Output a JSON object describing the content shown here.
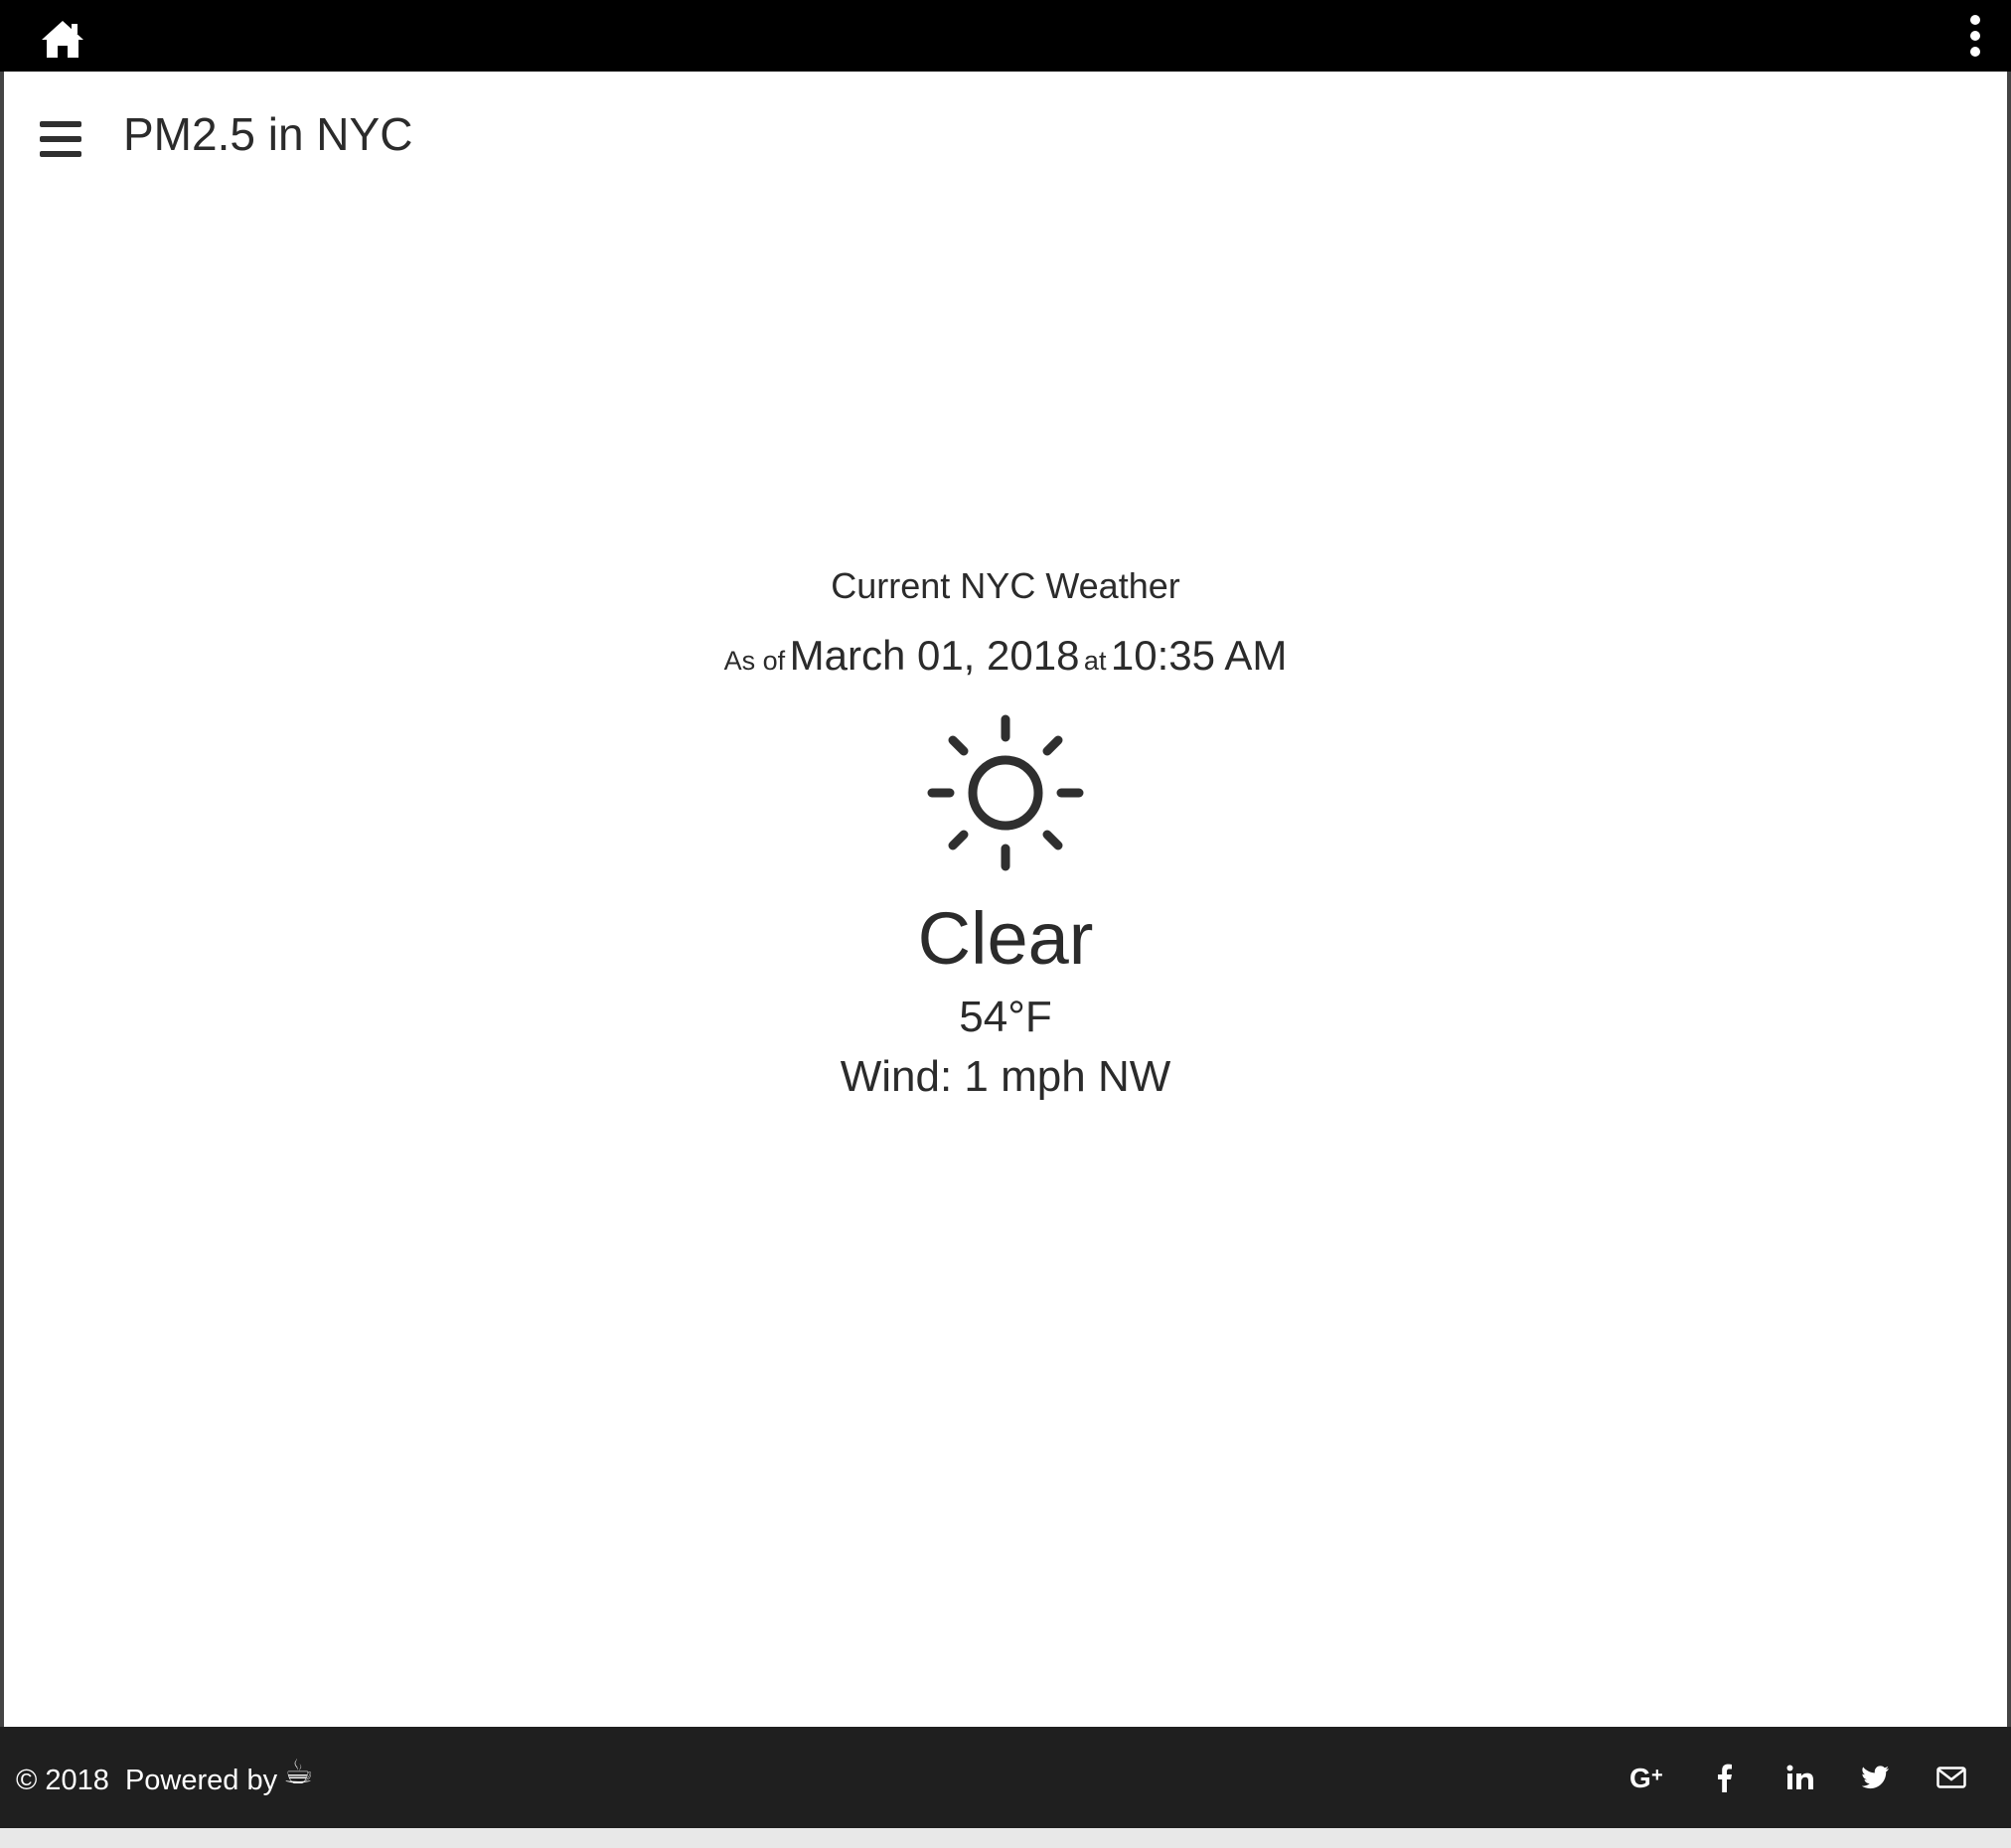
{
  "app": {
    "title": "PM2.5 in NYC"
  },
  "weather": {
    "heading": "Current NYC Weather",
    "as_of_prefix": "As of",
    "date": "March 01, 2018",
    "at_word": "at",
    "time": "10:35 AM",
    "icon": "sun-icon",
    "condition": "Clear",
    "temperature": "54°F",
    "wind": "Wind: 1 mph NW"
  },
  "footer": {
    "copyright": "© 2018",
    "powered_by": "Powered by",
    "powered_icon": "coffee-cup-icon",
    "cup_glyph": "☕",
    "socials": [
      {
        "name": "google-plus-icon",
        "glyph": "G+"
      },
      {
        "name": "facebook-icon",
        "glyph": "f"
      },
      {
        "name": "linkedin-icon",
        "glyph": "in"
      },
      {
        "name": "twitter-icon",
        "glyph": "twitter"
      },
      {
        "name": "email-icon",
        "glyph": "envelope"
      }
    ]
  },
  "colors": {
    "topbar": "#000000",
    "footer": "#1f1f1f",
    "text": "#2b2b2b"
  }
}
